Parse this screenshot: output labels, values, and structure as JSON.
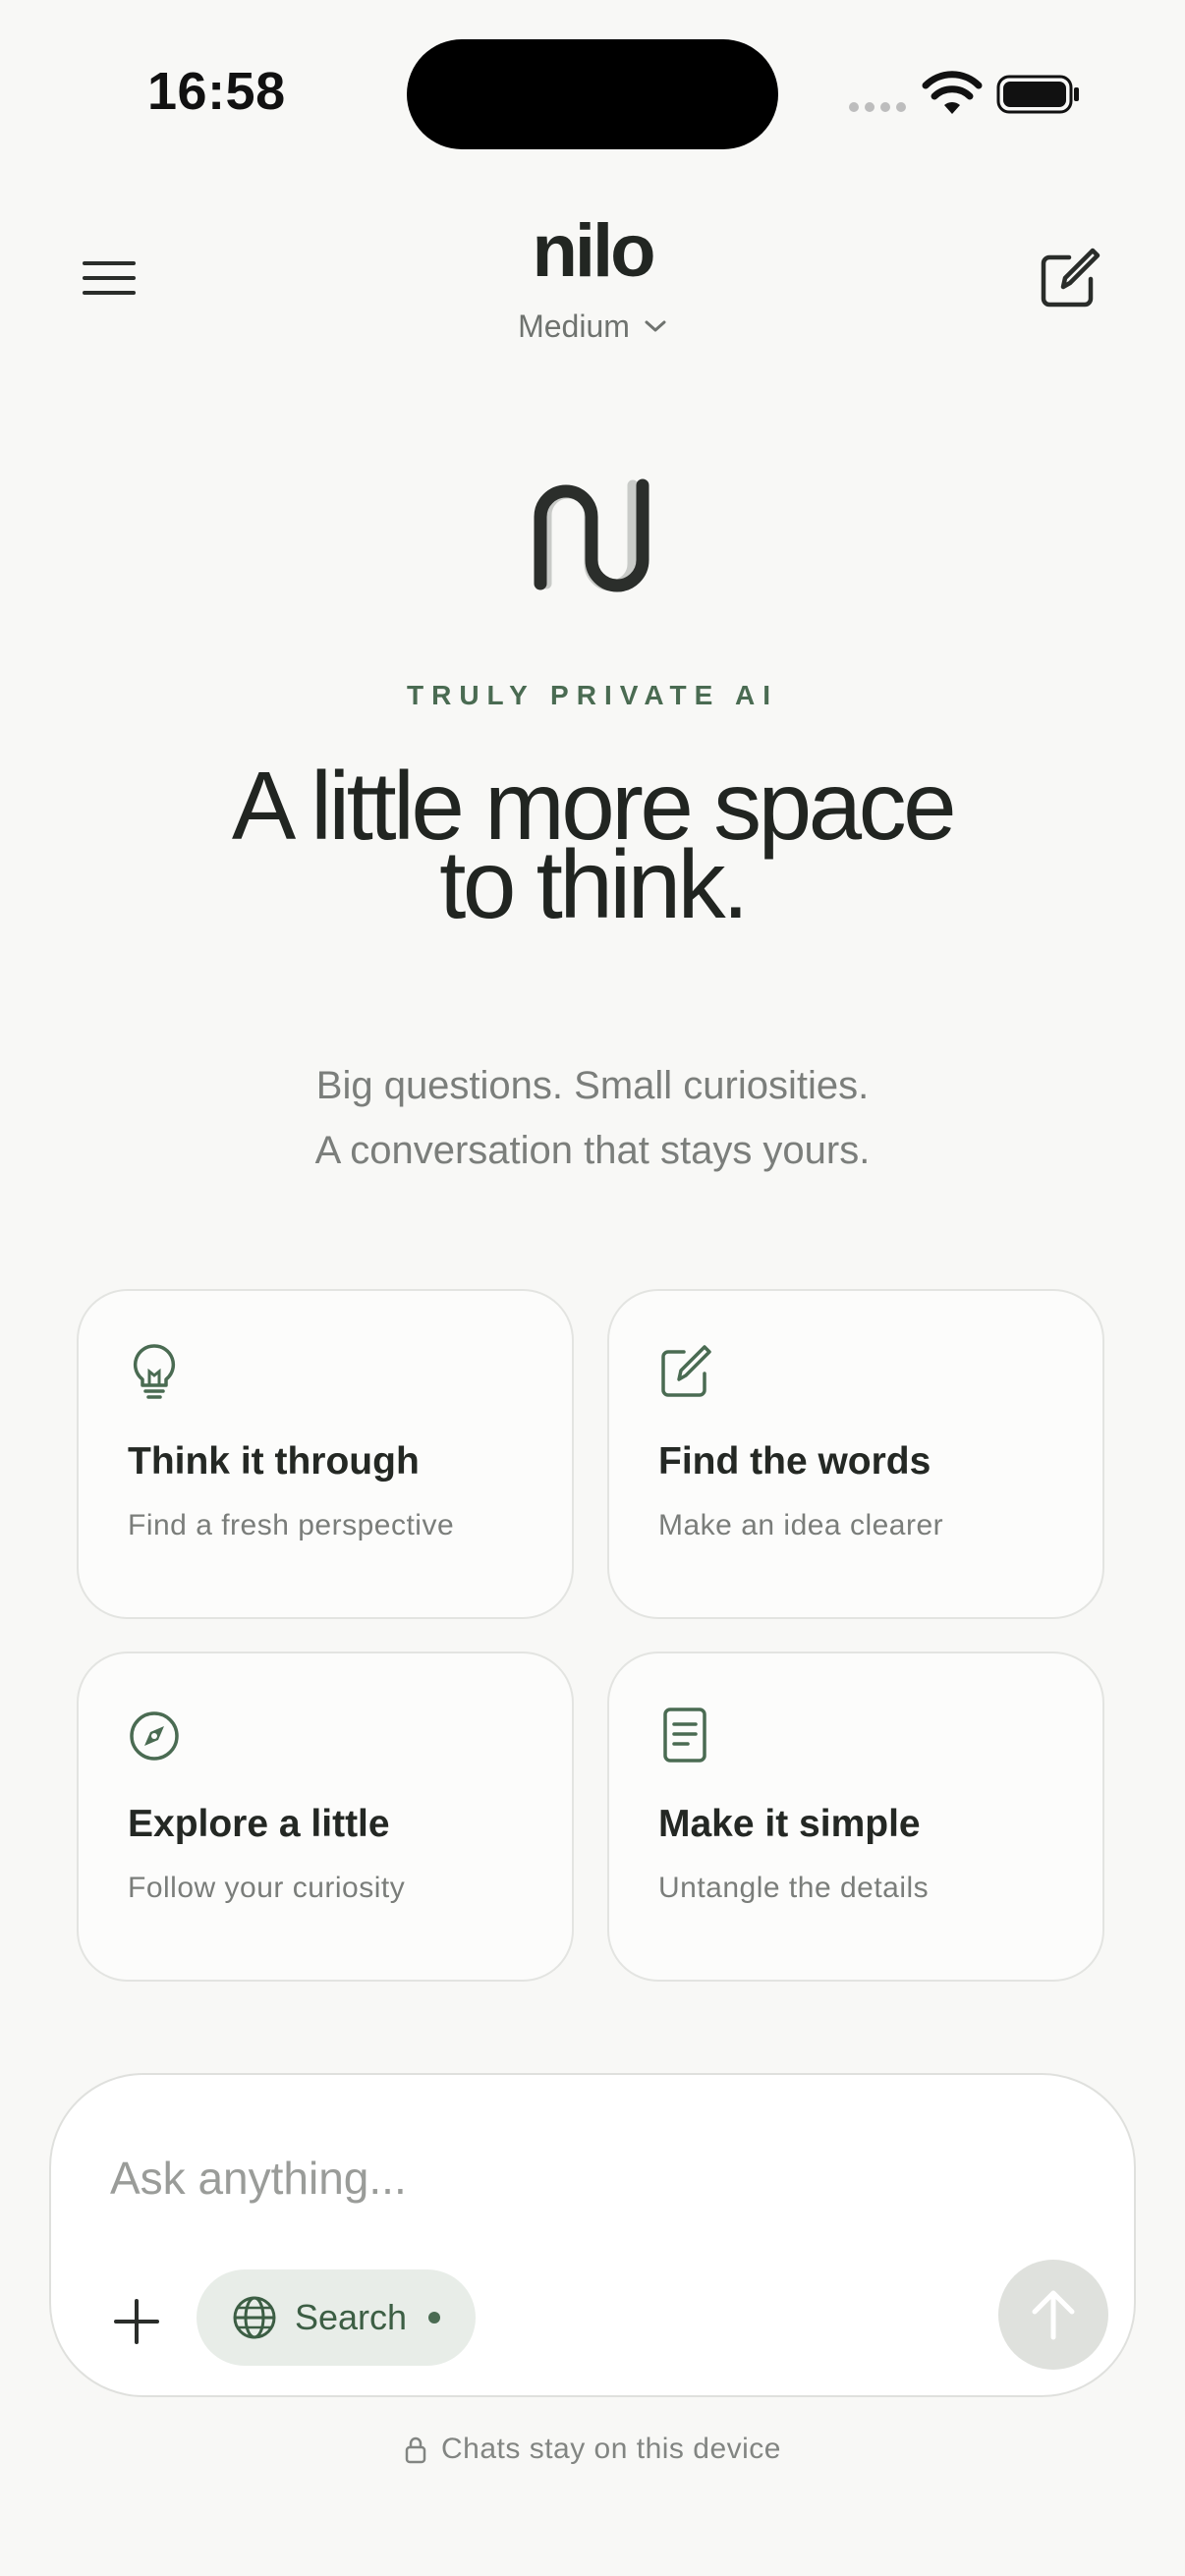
{
  "status_bar": {
    "time": "16:58"
  },
  "header": {
    "title": "nilo",
    "model": "Medium",
    "menu_icon": "hamburger-menu-icon",
    "compose_icon": "new-chat-icon"
  },
  "hero": {
    "eyebrow": "TRULY PRIVATE AI",
    "headline_line1": "A little more space",
    "headline_line2": "to think.",
    "subtitle_line1": "Big questions. Small curiosities.",
    "subtitle_line2": "A conversation that stays yours."
  },
  "suggestions": [
    {
      "icon": "lightbulb-icon",
      "title": "Think it through",
      "subtitle": "Find a fresh perspective"
    },
    {
      "icon": "edit-icon",
      "title": "Find the words",
      "subtitle": "Make an idea clearer"
    },
    {
      "icon": "compass-icon",
      "title": "Explore a little",
      "subtitle": "Follow your curiosity"
    },
    {
      "icon": "document-icon",
      "title": "Make it simple",
      "subtitle": "Untangle the details"
    }
  ],
  "composer": {
    "placeholder": "Ask anything...",
    "search_label": "Search",
    "send_icon": "arrow-up-icon"
  },
  "footer": {
    "note": "Chats stay on this device"
  },
  "colors": {
    "accent": "#4a6b52",
    "background": "#f8f8f6",
    "text": "#232723"
  }
}
